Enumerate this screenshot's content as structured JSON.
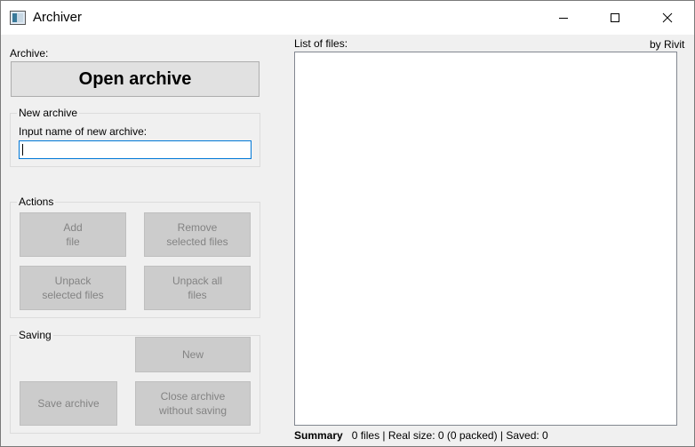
{
  "window": {
    "title": "Archiver",
    "controls": [
      "minimize-icon",
      "maximize-icon",
      "close-icon"
    ]
  },
  "left": {
    "archive_label": "Archive:",
    "open_archive_button": "Open archive",
    "new_archive": {
      "group_title": "New archive",
      "input_label": "Input name of new archive:",
      "input_value": ""
    },
    "actions": {
      "group_title": "Actions",
      "add_file_line1": "Add",
      "add_file_line2": "file",
      "remove_selected_line1": "Remove",
      "remove_selected_line2": "selected files",
      "unpack_selected_line1": "Unpack",
      "unpack_selected_line2": "selected files",
      "unpack_all_line1": "Unpack all",
      "unpack_all_line2": "files"
    },
    "saving": {
      "group_title": "Saving",
      "new_button": "New",
      "save_archive_button": "Save archive",
      "close_without_saving_line1": "Close archive",
      "close_without_saving_line2": "without saving"
    }
  },
  "right": {
    "list_label": "List of files:",
    "author": "by Rivit",
    "files": [],
    "summary_label": "Summary",
    "summary_text": "0 files | Real size: 0 (0 packed) | Saved: 0"
  }
}
